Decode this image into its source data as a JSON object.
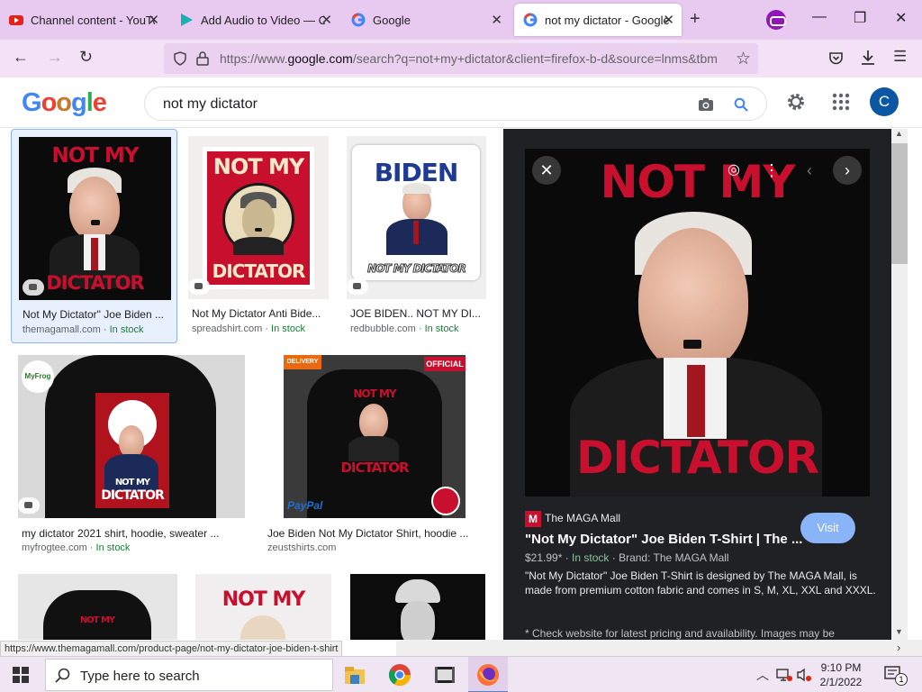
{
  "browser": {
    "tabs": [
      {
        "label": "Channel content - YouTu",
        "icon": "youtube-icon"
      },
      {
        "label": "Add Audio to Video — Cl",
        "icon": "clipchamp-icon"
      },
      {
        "label": "Google",
        "icon": "google-icon"
      },
      {
        "label": "not my dictator - Google",
        "icon": "google-icon",
        "active": true
      }
    ],
    "url_prefix": "https://www.",
    "url_domain": "google.com",
    "url_rest": "/search?q=not+my+dictator&client=firefox-b-d&source=lnms&tbm",
    "status_url": "https://www.themagamall.com/product-page/not-my-dictator-joe-biden-t-shirt"
  },
  "google": {
    "logo": "Google",
    "query": "not my dictator",
    "avatar_letter": "C"
  },
  "results": [
    {
      "title": "Not My Dictator\" Joe Biden ...",
      "source": "themagamall.com",
      "stock": "In stock",
      "poster_top": "NOT MY",
      "poster_bottom": "DICTATOR"
    },
    {
      "title": "Not My Dictator Anti Bide...",
      "source": "spreadshirt.com",
      "stock": "In stock",
      "poster_top": "NOT MY",
      "poster_bottom": "DICTATOR"
    },
    {
      "title": "JOE BIDEN.. NOT MY DI...",
      "source": "redbubble.com",
      "stock": "In stock",
      "poster_top": "BIDEN",
      "poster_bottom": "NOT MY DICTATOR"
    },
    {
      "title": "my dictator 2021 shirt, hoodie, sweater ...",
      "source": "myfrogtee.com",
      "stock": "In stock",
      "poster_top": "NOT MY",
      "poster_bottom": "DICTATOR",
      "brand": "MyFrog"
    },
    {
      "title": "Joe Biden Not My Dictator Shirt, hoodie ...",
      "source": "zeustshirts.com",
      "stock": "",
      "poster_top": "NOT MY",
      "poster_bottom": "DICTATOR",
      "badge": "OFFICIAL",
      "badge2": "DELIVERY",
      "pay": "PayPal"
    },
    {
      "title": "",
      "source": "",
      "stock": "",
      "poster_top": "NOT MY",
      "poster_bottom": ""
    },
    {
      "title": "",
      "source": "",
      "stock": "",
      "poster_top": "NOT MY",
      "poster_bottom": ""
    },
    {
      "title": "",
      "source": "",
      "stock": "",
      "poster_top": "",
      "poster_bottom": ""
    }
  ],
  "preview": {
    "poster_top": "NOT MY",
    "poster_bottom": "DICTATOR",
    "source_logo": "M",
    "source_name": "The MAGA Mall",
    "title": "\"Not My Dictator\" Joe Biden T-Shirt | The ...",
    "price": "$21.99*",
    "stock": "In stock",
    "brand": "Brand: The MAGA Mall",
    "description": "\"Not My Dictator\" Joe Biden T-Shirt is designed by The MAGA Mall, is made from premium cotton fabric and comes in S, M, XL, XXL and XXXL.",
    "note": "* Check website for latest pricing and availability. Images may be",
    "visit_label": "Visit"
  },
  "taskbar": {
    "search_placeholder": "Type here to search",
    "time": "9:10 PM",
    "date": "2/1/2022",
    "notification_count": "1"
  },
  "colors": {
    "tab_bg": "#e8c9f0",
    "nav_bg": "#f3e2f6",
    "poster_red": "#c8102e",
    "link_green": "#188038",
    "visit_blue": "#8ab4f8"
  }
}
